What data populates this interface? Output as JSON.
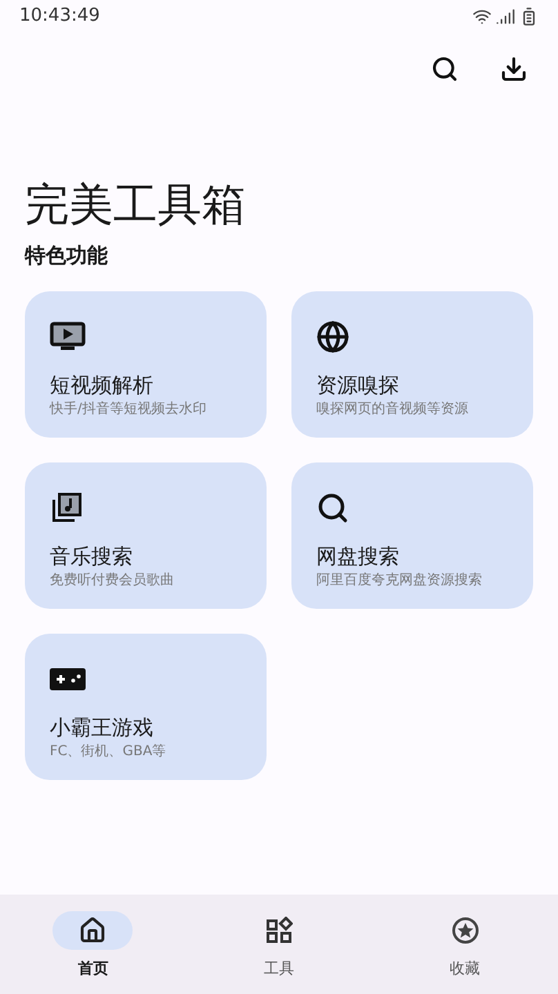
{
  "status_bar": {
    "time": "10:43:49"
  },
  "title": "完美工具箱",
  "section": "特色功能",
  "features": [
    {
      "kind": "video",
      "title": "短视频解析",
      "subtitle": "快手/抖音等短视频去水印"
    },
    {
      "kind": "globe",
      "title": "资源嗅探",
      "subtitle": "嗅探网页的音视频等资源"
    },
    {
      "kind": "music",
      "title": "音乐搜索",
      "subtitle": "免费听付费会员歌曲"
    },
    {
      "kind": "search",
      "title": "网盘搜索",
      "subtitle": "阿里百度夸克网盘资源搜索"
    },
    {
      "kind": "game",
      "title": "小霸王游戏",
      "subtitle": "FC、街机、GBA等"
    }
  ],
  "nav": [
    {
      "kind": "home",
      "label": "首页",
      "selected": true
    },
    {
      "kind": "tools",
      "label": "工具",
      "selected": false
    },
    {
      "kind": "favorites",
      "label": "收藏",
      "selected": false
    }
  ]
}
